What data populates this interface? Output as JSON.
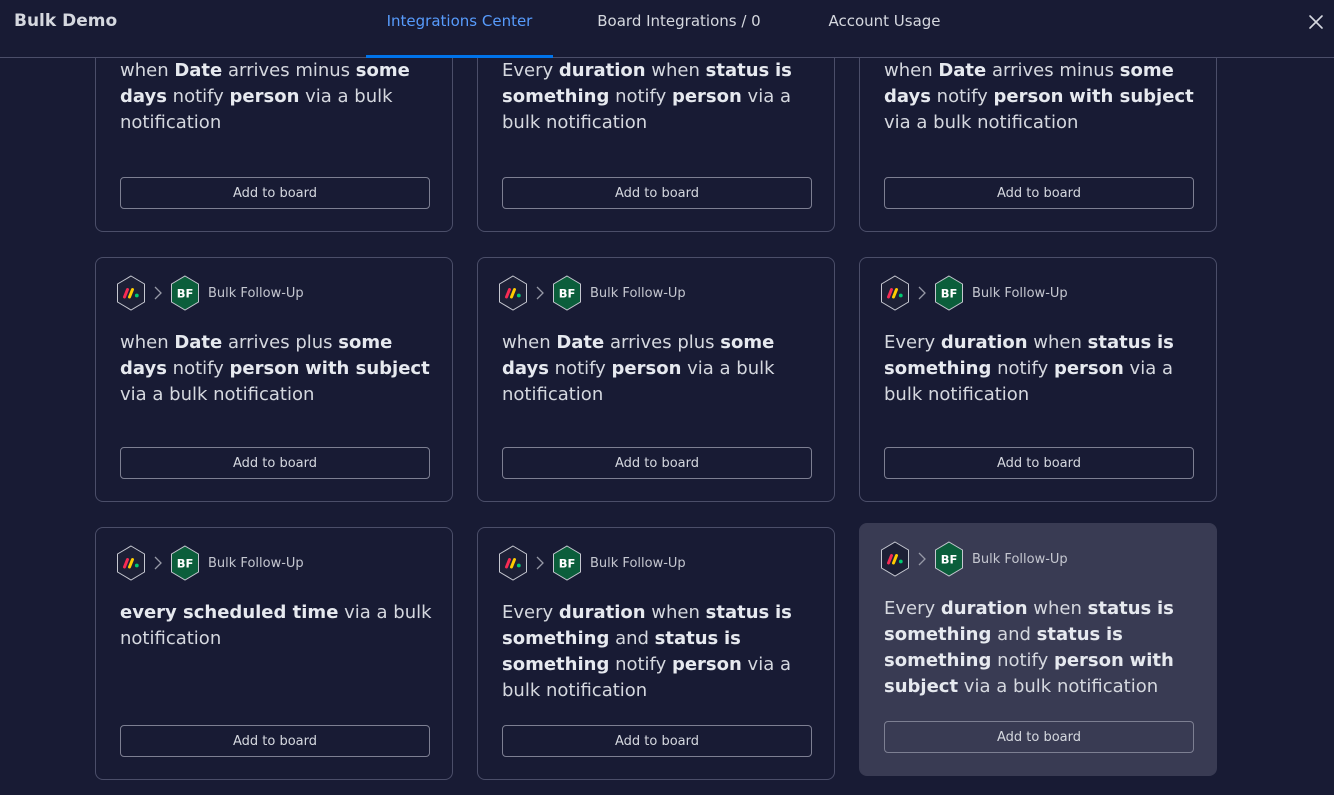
{
  "header": {
    "title": "Bulk Demo",
    "tabs": [
      "Integrations Center",
      "Board Integrations / 0",
      "Account Usage"
    ],
    "active_tab": 0
  },
  "integration_name": "Bulk Follow-Up",
  "badge": "BF",
  "add_label": "Add to board",
  "colors": {
    "background": "#181b34",
    "card_border": "#4b4e69",
    "card_hover": "#393b53",
    "accent": "#579bfc",
    "badge_bg": "#0b5e3b"
  },
  "cards": [
    {
      "recipe": [
        [
          "when ",
          0
        ],
        [
          "Date",
          1
        ],
        [
          " arrives minus ",
          0
        ],
        [
          "some days",
          1
        ],
        [
          " notify ",
          0
        ],
        [
          "person",
          1
        ],
        [
          " via a bulk notification",
          0
        ]
      ]
    },
    {
      "recipe": [
        [
          "Every ",
          0
        ],
        [
          "duration",
          1
        ],
        [
          " when ",
          0
        ],
        [
          "status",
          1
        ],
        [
          " ",
          0
        ],
        [
          "is",
          1
        ],
        [
          " ",
          0
        ],
        [
          "something",
          1
        ],
        [
          " notify ",
          0
        ],
        [
          "person",
          1
        ],
        [
          " via a bulk notification",
          0
        ]
      ]
    },
    {
      "recipe": [
        [
          "when ",
          0
        ],
        [
          "Date",
          1
        ],
        [
          " arrives minus ",
          0
        ],
        [
          "some days",
          1
        ],
        [
          " notify ",
          0
        ],
        [
          "person",
          1
        ],
        [
          " ",
          0
        ],
        [
          "with subject",
          1
        ],
        [
          " via a bulk notification",
          0
        ]
      ]
    },
    {
      "recipe": [
        [
          "when ",
          0
        ],
        [
          "Date",
          1
        ],
        [
          " arrives plus ",
          0
        ],
        [
          "some days",
          1
        ],
        [
          " notify ",
          0
        ],
        [
          "person",
          1
        ],
        [
          " ",
          0
        ],
        [
          "with subject",
          1
        ],
        [
          " via a bulk notification",
          0
        ]
      ]
    },
    {
      "recipe": [
        [
          "when ",
          0
        ],
        [
          "Date",
          1
        ],
        [
          " arrives plus ",
          0
        ],
        [
          "some days",
          1
        ],
        [
          " notify ",
          0
        ],
        [
          "person",
          1
        ],
        [
          " via a bulk notification",
          0
        ]
      ]
    },
    {
      "recipe": [
        [
          "Every ",
          0
        ],
        [
          "duration",
          1
        ],
        [
          " when ",
          0
        ],
        [
          "status",
          1
        ],
        [
          " ",
          0
        ],
        [
          "is",
          1
        ],
        [
          " ",
          0
        ],
        [
          "something",
          1
        ],
        [
          " notify ",
          0
        ],
        [
          "person",
          1
        ],
        [
          " via a bulk notification",
          0
        ]
      ]
    },
    {
      "recipe": [
        [
          "every scheduled time",
          1
        ],
        [
          " via a bulk notification",
          0
        ]
      ]
    },
    {
      "recipe": [
        [
          "Every ",
          0
        ],
        [
          "duration",
          1
        ],
        [
          " when ",
          0
        ],
        [
          "status",
          1
        ],
        [
          " ",
          0
        ],
        [
          "is",
          1
        ],
        [
          " ",
          0
        ],
        [
          "something",
          1
        ],
        [
          " and ",
          0
        ],
        [
          "status",
          1
        ],
        [
          " ",
          0
        ],
        [
          "is",
          1
        ],
        [
          " ",
          0
        ],
        [
          "something",
          1
        ],
        [
          " notify ",
          0
        ],
        [
          "person",
          1
        ],
        [
          " via a bulk notification",
          0
        ]
      ]
    },
    {
      "recipe": [
        [
          "Every ",
          0
        ],
        [
          "duration",
          1
        ],
        [
          " when ",
          0
        ],
        [
          "status",
          1
        ],
        [
          " ",
          0
        ],
        [
          "is",
          1
        ],
        [
          " ",
          0
        ],
        [
          "something",
          1
        ],
        [
          " and ",
          0
        ],
        [
          "status",
          1
        ],
        [
          " ",
          0
        ],
        [
          "is",
          1
        ],
        [
          " ",
          0
        ],
        [
          "something",
          1
        ],
        [
          " notify ",
          0
        ],
        [
          "person",
          1
        ],
        [
          " ",
          0
        ],
        [
          "with subject",
          1
        ],
        [
          " via a bulk notification",
          0
        ]
      ]
    }
  ]
}
